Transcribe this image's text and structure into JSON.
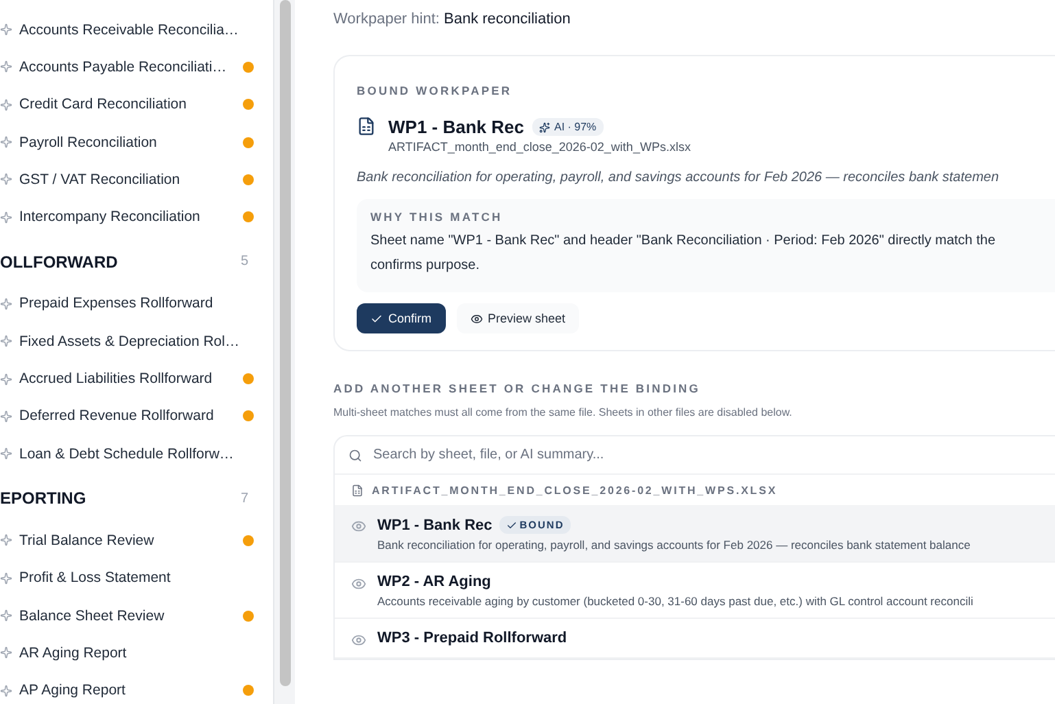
{
  "sidebar": {
    "groups": [
      {
        "items": [
          {
            "label": "Accounts Receivable Reconcilia…",
            "warning": false
          },
          {
            "label": "Accounts Payable Reconciliati…",
            "warning": true
          },
          {
            "label": "Credit Card Reconciliation",
            "warning": true
          },
          {
            "label": "Payroll Reconciliation",
            "warning": true
          },
          {
            "label": "GST / VAT Reconciliation",
            "warning": true
          },
          {
            "label": "Intercompany Reconciliation",
            "warning": true
          }
        ]
      },
      {
        "title": "OLLFORWARD",
        "count": "5",
        "items": [
          {
            "label": "Prepaid Expenses Rollforward",
            "warning": false
          },
          {
            "label": "Fixed Assets & Depreciation Rol…",
            "warning": false
          },
          {
            "label": "Accrued Liabilities Rollforward",
            "warning": true
          },
          {
            "label": "Deferred Revenue Rollforward",
            "warning": true
          },
          {
            "label": "Loan & Debt Schedule Rollforw…",
            "warning": false
          }
        ]
      },
      {
        "title": "EPORTING",
        "count": "7",
        "items": [
          {
            "label": "Trial Balance Review",
            "warning": true
          },
          {
            "label": "Profit & Loss Statement",
            "warning": false
          },
          {
            "label": "Balance Sheet Review",
            "warning": true
          },
          {
            "label": "AR Aging Report",
            "warning": false
          },
          {
            "label": "AP Aging Report",
            "warning": true
          }
        ]
      }
    ]
  },
  "hint": {
    "label": "Workpaper hint:",
    "value": "Bank reconciliation"
  },
  "bound": {
    "heading": "BOUND WORKPAPER",
    "name": "WP1 - Bank Rec",
    "badge": "AI · 97%",
    "file": "ARTIFACT_month_end_close_2026-02_with_WPs.xlsx",
    "description": "Bank reconciliation for operating, payroll, and savings accounts for Feb 2026 — reconciles bank statemen",
    "why_heading": "WHY THIS MATCH",
    "why_lines": [
      "Sheet name \"WP1 - Bank Rec\" and header \"Bank Reconciliation · Period: Feb 2026\" directly match the",
      "confirms purpose."
    ],
    "buttons": [
      {
        "label": "Confirm",
        "kind": "primary"
      },
      {
        "label": "Preview sheet",
        "kind": "secondary"
      }
    ]
  },
  "add": {
    "heading": "ADD ANOTHER SHEET OR CHANGE THE BINDING",
    "note": "Multi-sheet matches must all come from the same file. Sheets in other files are disabled below.",
    "search": {
      "placeholder": "Search by sheet, file, or AI summary..."
    },
    "file_group": "ARTIFACT_MONTH_END_CLOSE_2026-02_WITH_WPS.XLSX",
    "sheets": [
      {
        "name": "WP1 - Bank Rec",
        "badge": "BOUND",
        "selected": true,
        "description": "Bank reconciliation for operating, payroll, and savings accounts for Feb 2026 — reconciles bank statement balance"
      },
      {
        "name": "WP2 - AR Aging",
        "selected": false,
        "description": "Accounts receivable aging by customer (bucketed 0-30, 31-60 days past due, etc.) with GL control account reconcili"
      },
      {
        "name": "WP3 - Prepaid Rollforward",
        "selected": false
      }
    ]
  }
}
